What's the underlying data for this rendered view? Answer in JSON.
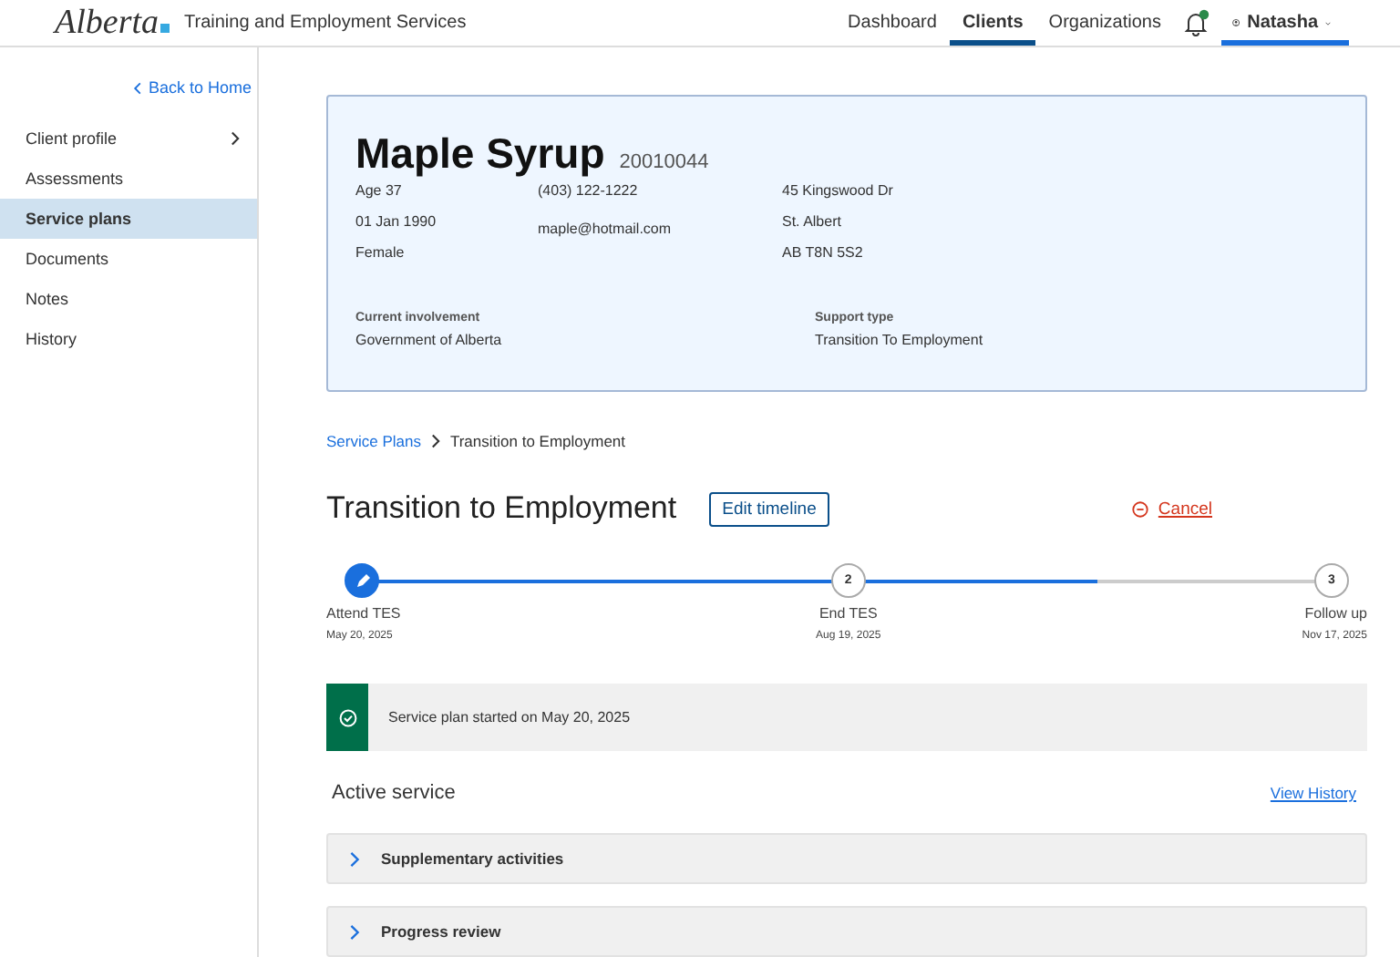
{
  "header": {
    "logo": "Alberta",
    "app_title": "Training and Employment Services",
    "nav": [
      {
        "label": "Dashboard",
        "selected": false
      },
      {
        "label": "Clients",
        "selected": true
      },
      {
        "label": "Organizations",
        "selected": false
      }
    ],
    "user": {
      "name": "Natasha",
      "selected": true
    }
  },
  "sidebar": {
    "back_link": "Back to Home",
    "items": [
      {
        "label": "Client profile",
        "selected": false,
        "has_submenu": true
      },
      {
        "label": "Assessments",
        "selected": false,
        "has_submenu": false
      },
      {
        "label": "Service plans",
        "selected": true,
        "has_submenu": false
      },
      {
        "label": "Documents",
        "selected": false,
        "has_submenu": false
      },
      {
        "label": "Notes",
        "selected": false,
        "has_submenu": false
      },
      {
        "label": "History",
        "selected": false,
        "has_submenu": false
      }
    ]
  },
  "client_card": {
    "name": "Maple Syrup",
    "client_id": "20010044",
    "columns": [
      [
        "Age 37",
        "01 Jan 1990",
        "Female"
      ],
      [
        "(403) 122-1222",
        "maple@hotmail.com"
      ],
      [
        "45 Kingswood Dr",
        "St. Albert",
        "AB T8N 5S2"
      ]
    ],
    "fields": [
      {
        "label": "Current involvement",
        "value": "Government of Alberta"
      },
      {
        "label": "Support type",
        "value": "Transition To Employment"
      }
    ]
  },
  "breadcrumb": [
    {
      "label": "Service Plans",
      "kind": "link"
    },
    {
      "label": "Transition to Employment",
      "kind": "current"
    }
  ],
  "plan": {
    "title": "Transition to Employment",
    "edit_button": "Edit timeline",
    "cancel_link": "Cancel"
  },
  "timeline": {
    "level": 0.75,
    "steps": [
      {
        "kind": "current",
        "label": "Attend TES",
        "date": "May 20, 2025"
      },
      {
        "kind": "upcoming",
        "number": "2",
        "label": "End TES",
        "date": "Aug 19, 2025"
      },
      {
        "kind": "upcoming",
        "number": "3",
        "label": "Follow up",
        "date": "Nov 17, 2025"
      }
    ]
  },
  "banner": {
    "kind": "success",
    "message": "Service plan started on May 20, 2025"
  },
  "active_service": {
    "title": "Active service",
    "history_link": "View History",
    "sections": [
      {
        "label": "Supplementary activities",
        "expanded": false
      },
      {
        "label": "Progress review",
        "expanded": false
      }
    ]
  }
}
